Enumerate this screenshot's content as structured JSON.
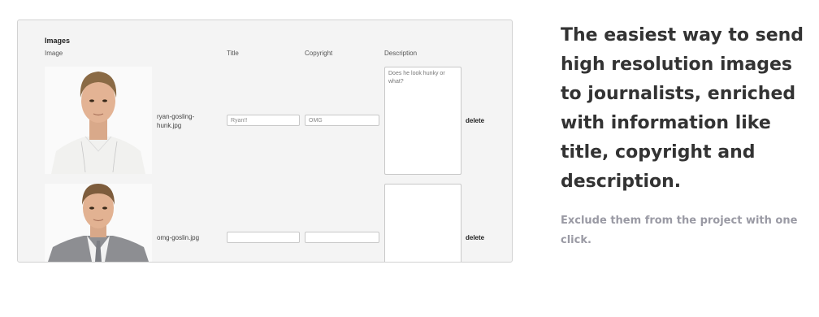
{
  "table": {
    "section_title": "Images",
    "columns": {
      "image": "Image",
      "title": "Title",
      "copyright": "Copyright",
      "description": "Description"
    },
    "rows": [
      {
        "filename": "ryan-gosling-hunk.jpg",
        "title": "Ryan!!",
        "copyright": "OMG",
        "description": "Does he look hunky or what?",
        "delete_label": "delete"
      },
      {
        "filename": "omg-goslin.jpg",
        "title": "",
        "copyright": "",
        "description": "",
        "delete_label": "delete"
      }
    ]
  },
  "marketing": {
    "headline": "The easiest way to send high resolution images to journalists, enriched with information like title, copyright and description.",
    "subtext": "Exclude them from the project with one click."
  }
}
